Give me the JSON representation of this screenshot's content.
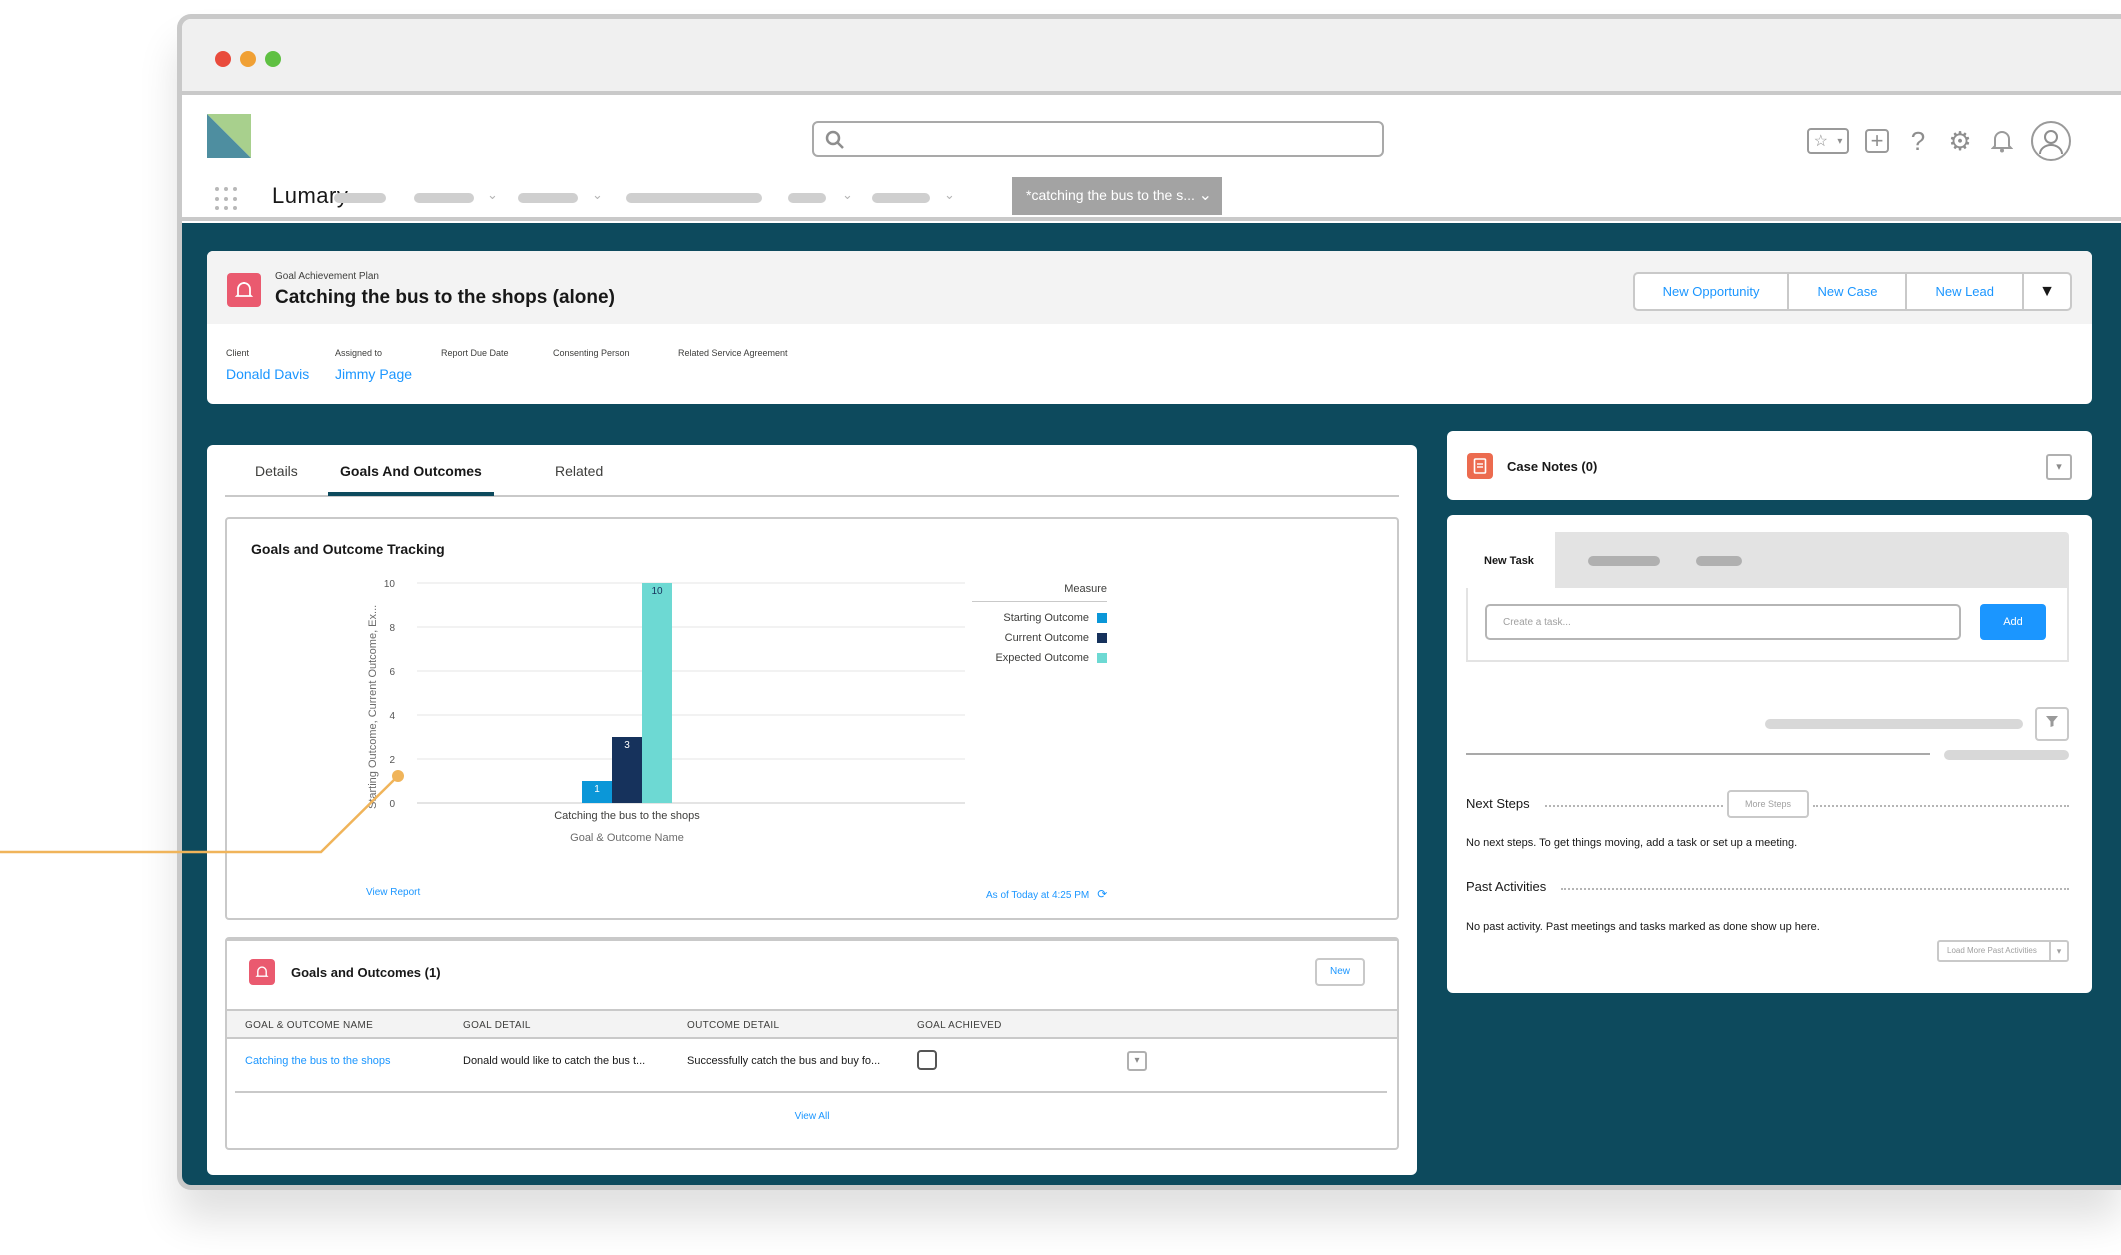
{
  "app": {
    "name": "Lumary",
    "active_tab_label": "*catching the bus to the s...",
    "colors": {
      "brand_dark": "#0d4a5d",
      "link": "#1b96ff",
      "record_icon": "#ea5a6f",
      "callout": "#f0b45a"
    }
  },
  "search": {
    "placeholder": ""
  },
  "utility_icons": [
    "favorites-icon",
    "add-icon",
    "help-icon",
    "gear-icon",
    "bell-icon",
    "avatar-icon"
  ],
  "highlights": {
    "record_type": "Goal Achievement Plan",
    "title": "Catching the bus to the shops (alone)",
    "actions": [
      "New Opportunity",
      "New Case",
      "New Lead"
    ],
    "fields": [
      {
        "label": "Client",
        "value": "Donald Davis"
      },
      {
        "label": "Assigned to",
        "value": "Jimmy Page"
      },
      {
        "label": "Report Due Date",
        "value": ""
      },
      {
        "label": "Consenting Person",
        "value": ""
      },
      {
        "label": "Related Service Agreement",
        "value": ""
      }
    ]
  },
  "tabs": [
    "Details",
    "Goals And Outcomes",
    "Related"
  ],
  "chart_card": {
    "title": "Goals and Outcome Tracking",
    "view_report": "View Report",
    "as_of": "As of Today at 4:25 PM"
  },
  "chart_data": {
    "type": "bar",
    "categories": [
      "Catching the bus to the shops"
    ],
    "series": [
      {
        "name": "Starting Outcome",
        "values": [
          1
        ],
        "color": "#0b97d8"
      },
      {
        "name": "Current Outcome",
        "values": [
          3
        ],
        "color": "#16325c"
      },
      {
        "name": "Expected Outcome",
        "values": [
          10
        ],
        "color": "#6dd9d3"
      }
    ],
    "title": "Goals and Outcome Tracking",
    "xlabel": "Goal & Outcome Name",
    "ylabel": "Starting Outcome, Current Outcome, Ex...",
    "legend_title": "Measure",
    "yticks": [
      0,
      2,
      4,
      6,
      8,
      10
    ],
    "ylim": [
      0,
      10
    ],
    "legend": "right"
  },
  "goals_list": {
    "title": "Goals and Outcomes (1)",
    "new_label": "New",
    "columns": [
      "GOAL & OUTCOME NAME",
      "GOAL DETAIL",
      "OUTCOME DETAIL",
      "GOAL ACHIEVED"
    ],
    "rows": [
      {
        "name": "Catching the bus to the shops",
        "goal_detail": "Donald would like to catch the bus t...",
        "outcome_detail": "Successfully catch the bus and buy fo...",
        "achieved": false
      }
    ],
    "view_all": "View All"
  },
  "case_notes": {
    "title": "Case Notes (0)"
  },
  "activity": {
    "active_tab": "New Task",
    "task_placeholder": "Create a task...",
    "add_label": "Add",
    "next_steps_title": "Next Steps",
    "more_steps": "More Steps",
    "next_steps_empty": "No next steps. To get things moving, add a task or set up a meeting.",
    "past_title": "Past Activities",
    "past_empty": "No past activity. Past meetings and tasks marked as done show up here.",
    "load_more": "Load More Past Activities"
  }
}
